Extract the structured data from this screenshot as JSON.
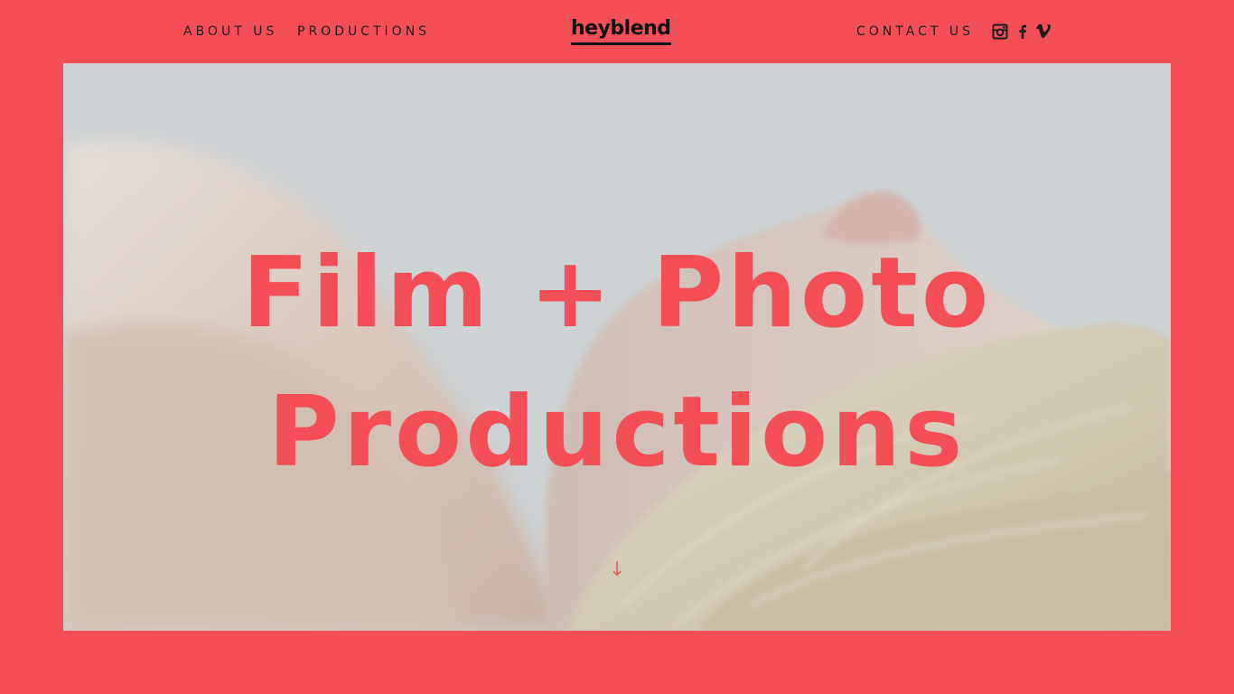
{
  "nav": {
    "about_label": "ABOUT US",
    "productions_label": "PRODUCTIONS",
    "contact_label": "CONTACT US"
  },
  "brand": {
    "logo_text": "heyblend",
    "accent_color": "#f44f57",
    "text_color": "#1b1b1b"
  },
  "social": {
    "icons": [
      "instagram-icon",
      "facebook-icon",
      "vimeo-icon"
    ]
  },
  "hero": {
    "headline_line1": "Film + Photo",
    "headline_line2": "Productions",
    "scroll_glyph": "↓",
    "background_image": "close-up of a blonde woman lying down, head tilted back"
  }
}
